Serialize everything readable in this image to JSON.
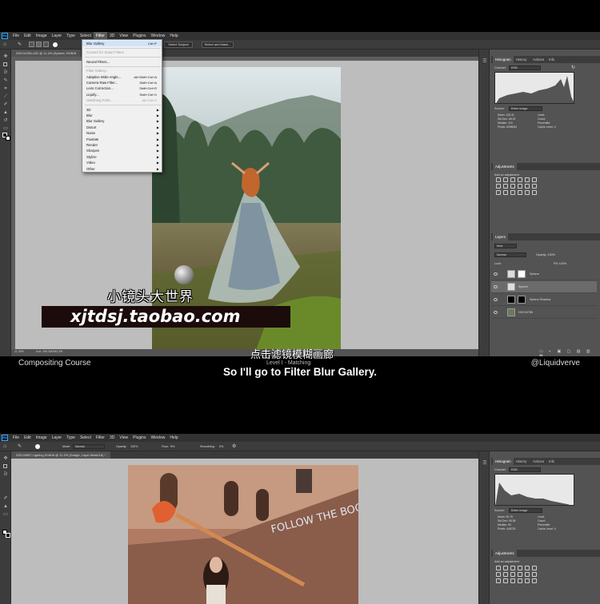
{
  "app": {
    "logo": "Ps",
    "menu": [
      "File",
      "Edit",
      "Image",
      "Layer",
      "Type",
      "Select",
      "Filter",
      "3D",
      "View",
      "Plugins",
      "Window",
      "Help"
    ],
    "active_menu": "Filter"
  },
  "top": {
    "options": {
      "select_subject": "Select Subject",
      "select_and_mask": "Select and Mask..."
    },
    "doc_tab": "DSC04785-12E @ 11.4% (Sphere, RGB/8",
    "status_left": "11.39%",
    "status_right": "Doc: 165.3M/582.3M",
    "filter_menu": {
      "items": [
        {
          "label": "Blur Gallery",
          "shortcut": "Ctrl+F",
          "highlight": true
        },
        {
          "sep": true
        },
        {
          "label": "Convert for Smart Filters",
          "disabled": true
        },
        {
          "sep": true
        },
        {
          "label": "Neural Filters..."
        },
        {
          "sep": true
        },
        {
          "label": "Filter Gallery...",
          "disabled": true
        },
        {
          "label": "Adaptive Wide Angle...",
          "shortcut": "Alt+Shift+Ctrl+A"
        },
        {
          "label": "Camera Raw Filter...",
          "shortcut": "Shift+Ctrl+A"
        },
        {
          "label": "Lens Correction...",
          "shortcut": "Shift+Ctrl+R"
        },
        {
          "label": "Liquify...",
          "shortcut": "Shift+Ctrl+X"
        },
        {
          "label": "Vanishing Point...",
          "shortcut": "Alt+Ctrl+V",
          "disabled": true
        },
        {
          "sep": true
        },
        {
          "label": "3D",
          "submenu": true
        },
        {
          "label": "Blur",
          "submenu": true
        },
        {
          "label": "Blur Gallery",
          "submenu": true
        },
        {
          "label": "Distort",
          "submenu": true
        },
        {
          "label": "Noise",
          "submenu": true
        },
        {
          "label": "Pixelate",
          "submenu": true
        },
        {
          "label": "Render",
          "submenu": true
        },
        {
          "label": "Sharpen",
          "submenu": true
        },
        {
          "label": "Stylize",
          "submenu": true
        },
        {
          "label": "Video",
          "submenu": true
        },
        {
          "label": "Other",
          "submenu": true
        }
      ]
    },
    "panels": {
      "tabs": [
        "Histogram",
        "History",
        "Actions",
        "Info"
      ],
      "channel_label": "Channel:",
      "channel_value": "RGB",
      "source_label": "Source:",
      "source_value": "Entire Image",
      "stats_left": [
        "Mean: 125.41",
        "Std Dev: 66.02",
        "Median: 124",
        "Pixels: 6098052"
      ],
      "stats_right": [
        "Level:",
        "Count:",
        "Percentile:",
        "Cache Level: 4"
      ],
      "adjustments_title": "Adjustments",
      "adjustments_sub": "Add an adjustment",
      "layers_title": "Layers",
      "kind_label": "Kind",
      "blend_mode": "Normal",
      "opacity_label": "Opacity: 100%",
      "lock_label": "Lock:",
      "fill_label": "Fill: 100%",
      "layers": [
        {
          "name": "Sphere",
          "selected": false
        },
        {
          "name": "Sphere",
          "selected": true
        },
        {
          "name": "Sphere Shadow",
          "selected": false
        },
        {
          "name": "DSC04785",
          "selected": false
        }
      ]
    }
  },
  "overlays": {
    "watermark_cn": "小镜头大世界",
    "watermark_url": "xjtdsj.taobao.com",
    "subtitle_cn": "点击滤镜模糊画廊",
    "course": "Compositing Course",
    "level": "Level I - Matching",
    "subtitle_en": "So I'll go to Filter Blur Gallery.",
    "handle": "@Liquidverve"
  },
  "bottom": {
    "options": {
      "mode_label": "Mode:",
      "mode_value": "Normal",
      "opacity_label": "Opacity:",
      "opacity_value": "100%",
      "flow_label": "Flow:",
      "flow_value": "5%",
      "smoothing_label": "Smoothing:",
      "smoothing_value": "0%"
    },
    "doc_tab": "DSC03657 Lighting Shift.tif @ 11.2% (Dodge, Layer Mask/16) *",
    "panels": {
      "tabs": [
        "Histogram",
        "History",
        "Actions",
        "Info"
      ],
      "channel_label": "Channel:",
      "channel_value": "RGB",
      "source_label": "Source:",
      "source_value": "Entire Image",
      "stats_left": [
        "Mean: 90.76",
        "Std Dev: 55.38",
        "Median: 83",
        "Pixels: 448733"
      ],
      "stats_right": [
        "Level:",
        "Count:",
        "Percentile:",
        "Cache Level: 4"
      ],
      "adjustments_title": "Adjustments",
      "adjustments_sub": "Add an adjustment"
    },
    "wall_text": "FOLLOW THE BOO STEP FLI"
  }
}
